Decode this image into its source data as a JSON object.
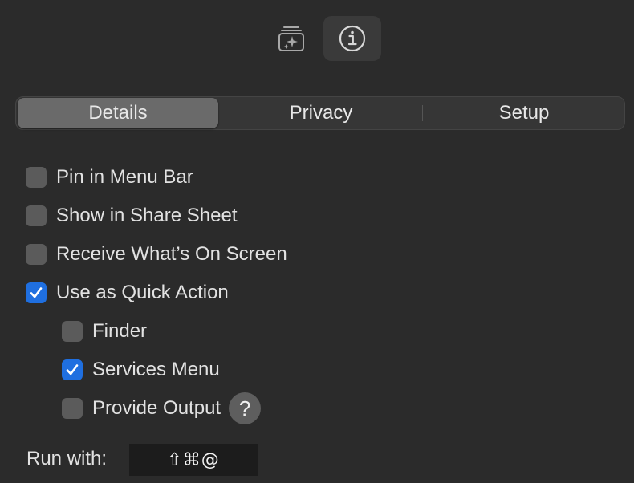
{
  "toolbar": {
    "gallery_icon": "sparkles-stack-icon",
    "info_icon": "info-circle-icon"
  },
  "tabs": [
    {
      "label": "Details",
      "selected": true
    },
    {
      "label": "Privacy",
      "selected": false
    },
    {
      "label": "Setup",
      "selected": false
    }
  ],
  "options": {
    "pin_menu_bar": {
      "label": "Pin in Menu Bar",
      "checked": false
    },
    "share_sheet": {
      "label": "Show in Share Sheet",
      "checked": false
    },
    "receive_screen": {
      "label": "Receive What’s On Screen",
      "checked": false
    },
    "quick_action": {
      "label": "Use as Quick Action",
      "checked": true
    },
    "finder": {
      "label": "Finder",
      "checked": false
    },
    "services_menu": {
      "label": "Services Menu",
      "checked": true
    },
    "provide_output": {
      "label": "Provide Output",
      "checked": false
    }
  },
  "help_glyph": "?",
  "run_with": {
    "label": "Run with:",
    "shortcut": "⇧⌘@"
  },
  "colors": {
    "background": "#2b2b2b",
    "checkbox_checked": "#1f6fe0",
    "segment_selected": "#6a6a6a"
  }
}
